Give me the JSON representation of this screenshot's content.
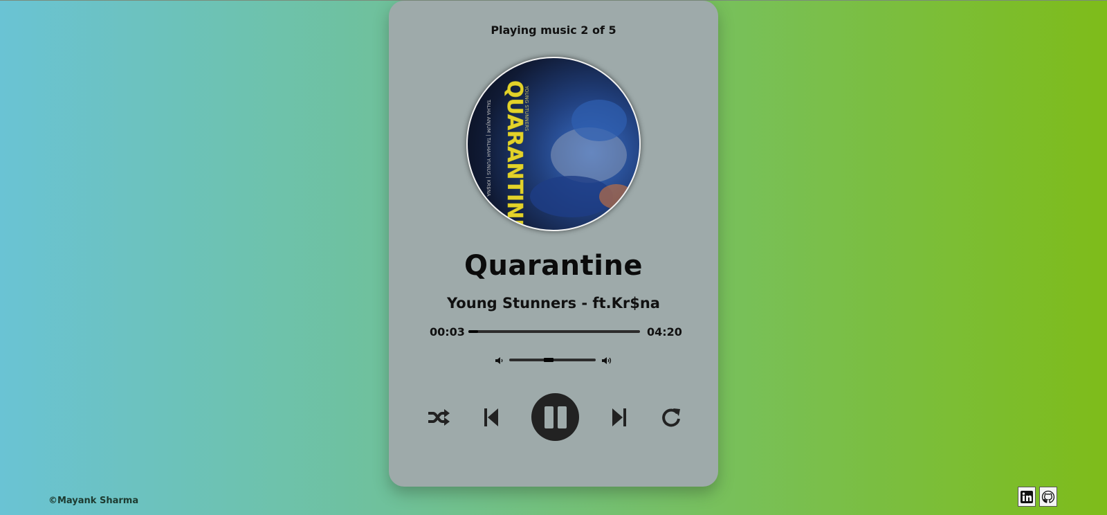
{
  "player": {
    "now_playing": "Playing music 2 of 5",
    "track_title": "Quarantine",
    "artist": "Young Stunners - ft.Kr$na",
    "current_time": "00:03",
    "duration": "04:20",
    "progress_fraction": 0.012,
    "volume_fraction": 0.4,
    "is_playing": true,
    "album_art": {
      "text": "QUARANTINE",
      "subtext": "YOUNG STUNNERS",
      "credits": "TALHA ANJUM | TALHAH YUNUS | KR$NA"
    },
    "controls": {
      "shuffle_icon": "shuffle-icon",
      "previous_icon": "skip-back-icon",
      "play_pause_icon": "pause-icon",
      "next_icon": "skip-forward-icon",
      "repeat_icon": "repeat-icon",
      "volume_down_icon": "volume-low-icon",
      "volume_up_icon": "volume-high-icon"
    }
  },
  "footer": {
    "credit": "©Mayank Sharma",
    "links": [
      {
        "icon": "linkedin-icon"
      },
      {
        "icon": "github-icon"
      }
    ]
  },
  "colors": {
    "card": "#9eaaaa",
    "accent_dark": "#222222",
    "gradient_start": "#6ac3d4",
    "gradient_end": "#7ebc1a"
  }
}
